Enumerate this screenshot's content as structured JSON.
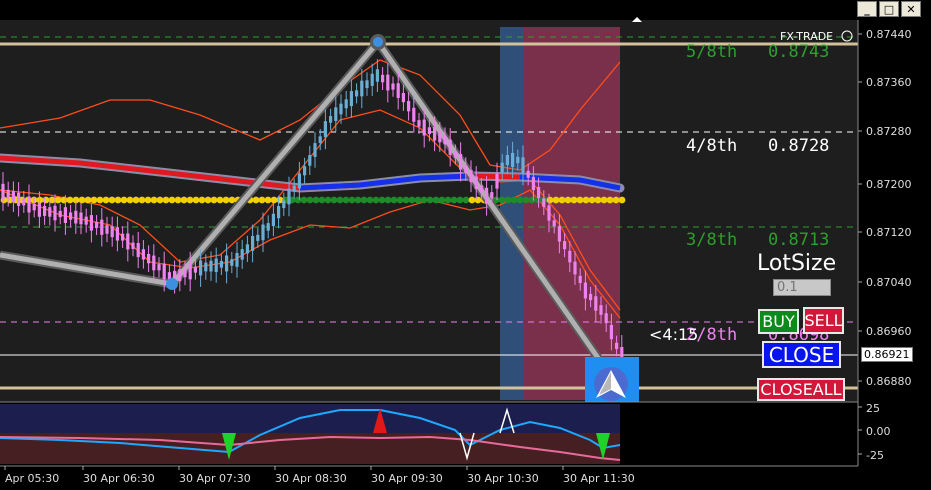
{
  "window": {
    "controls": [
      {
        "name": "minimize",
        "glyph": "_"
      },
      {
        "name": "maximize",
        "glyph": "□"
      },
      {
        "name": "close",
        "glyph": "✕"
      }
    ]
  },
  "terminal": {
    "name": "FX-TRADE"
  },
  "price_axis": {
    "ticks": [
      "0.87440",
      "0.87360",
      "0.87280",
      "0.87200",
      "0.87120",
      "0.87040",
      "0.86960",
      "0.86880"
    ],
    "current_price": "0.86921"
  },
  "time_axis": {
    "ticks": [
      "Apr 05:30",
      "30 Apr 06:30",
      "30 Apr 07:30",
      "30 Apr 08:30",
      "30 Apr 09:30",
      "30 Apr 10:30",
      "30 Apr 11:30"
    ]
  },
  "indicator_axis": {
    "ticks": [
      "25",
      "0.00",
      "-25"
    ]
  },
  "murrey_levels": [
    {
      "label": "5/8th",
      "value": "0.8743",
      "color": "#2ca02c"
    },
    {
      "label": "4/8th",
      "value": "0.8728",
      "color": "#ffffff"
    },
    {
      "label": "3/8th",
      "value": "0.8713",
      "color": "#2ca02c"
    },
    {
      "label": "2/8th",
      "value": "0.8698",
      "color": "#ee82ee"
    }
  ],
  "trade_panel": {
    "lot_label": "LotSize",
    "lot_placeholder": "0.1",
    "buy_label": "BUY",
    "sell_label": "SELL",
    "close_label": "CLOSE",
    "closeall_label": "CLOSEALL"
  },
  "timer": "<4:15",
  "colors": {
    "bull": "#6aaed6",
    "bear": "#ee82ee",
    "background": "#000000"
  }
}
